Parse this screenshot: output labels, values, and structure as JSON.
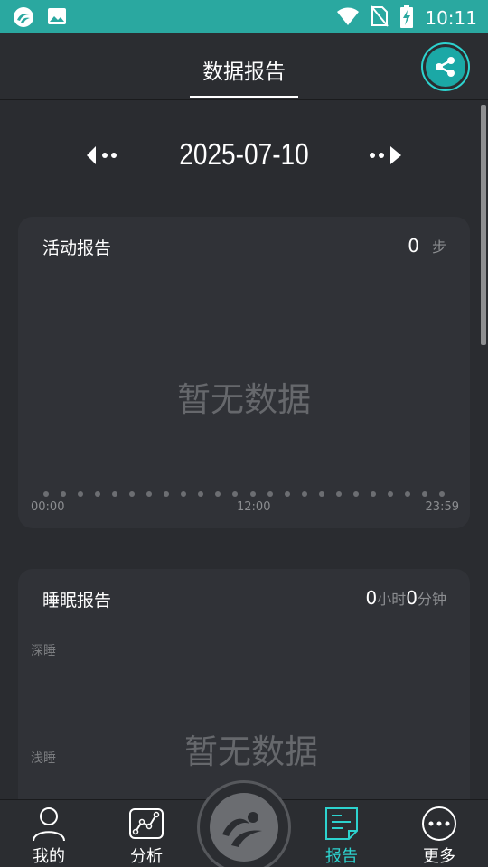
{
  "status_bar": {
    "time": "10:11"
  },
  "header": {
    "title": "数据报告"
  },
  "date_nav": {
    "date": "2025-07-10"
  },
  "activity_card": {
    "title": "活动报告",
    "value": "0",
    "unit": "步",
    "empty_text": "暂无数据",
    "ticks": [
      "00:00",
      "12:00",
      "23:59"
    ]
  },
  "sleep_card": {
    "title": "睡眠报告",
    "hours": "0",
    "hours_unit": "小时",
    "minutes": "0",
    "minutes_unit": "分钟",
    "empty_text": "暂无数据",
    "labels": [
      "深睡",
      "浅睡"
    ]
  },
  "bottom_nav": {
    "items": [
      {
        "label": "我的",
        "icon": "person-icon"
      },
      {
        "label": "分析",
        "icon": "analysis-chart-icon"
      },
      {
        "label": "报告",
        "icon": "report-icon",
        "active": true
      },
      {
        "label": "更多",
        "icon": "more-icon"
      }
    ]
  },
  "colors": {
    "accent": "#2dd3cf",
    "status_bar": "#2aa8a0",
    "background": "#2a2c30",
    "card": "#303237"
  }
}
